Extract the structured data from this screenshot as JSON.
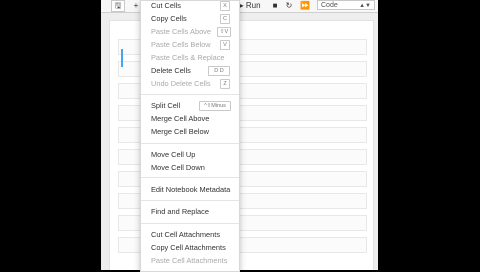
{
  "toolbar": {
    "run_label": "Run",
    "cell_type": "Code"
  },
  "menu": {
    "items": [
      {
        "label": "Cut Cells",
        "enabled": true,
        "shortcut": "X"
      },
      {
        "label": "Copy Cells",
        "enabled": true,
        "shortcut": "C"
      },
      {
        "label": "Paste Cells Above",
        "enabled": false,
        "shortcut": "⇧V"
      },
      {
        "label": "Paste Cells Below",
        "enabled": false,
        "shortcut": "V"
      },
      {
        "label": "Paste Cells & Replace",
        "enabled": false
      },
      {
        "label": "Delete Cells",
        "enabled": true,
        "shortcut": "D D"
      },
      {
        "label": "Undo Delete Cells",
        "enabled": false,
        "shortcut": "Z"
      },
      {
        "label": "Split Cell",
        "enabled": true,
        "shortcut": "^⇧Minus"
      },
      {
        "label": "Merge Cell Above",
        "enabled": true
      },
      {
        "label": "Merge Cell Below",
        "enabled": true
      },
      {
        "label": "Move Cell Up",
        "enabled": true
      },
      {
        "label": "Move Cell Down",
        "enabled": true
      },
      {
        "label": "Edit Notebook Metadata",
        "enabled": true
      },
      {
        "label": "Find and Replace",
        "enabled": true
      },
      {
        "label": "Cut Cell Attachments",
        "enabled": true
      },
      {
        "label": "Copy Cell Attachments",
        "enabled": true
      },
      {
        "label": "Paste Cell Attachments",
        "enabled": false
      }
    ]
  }
}
